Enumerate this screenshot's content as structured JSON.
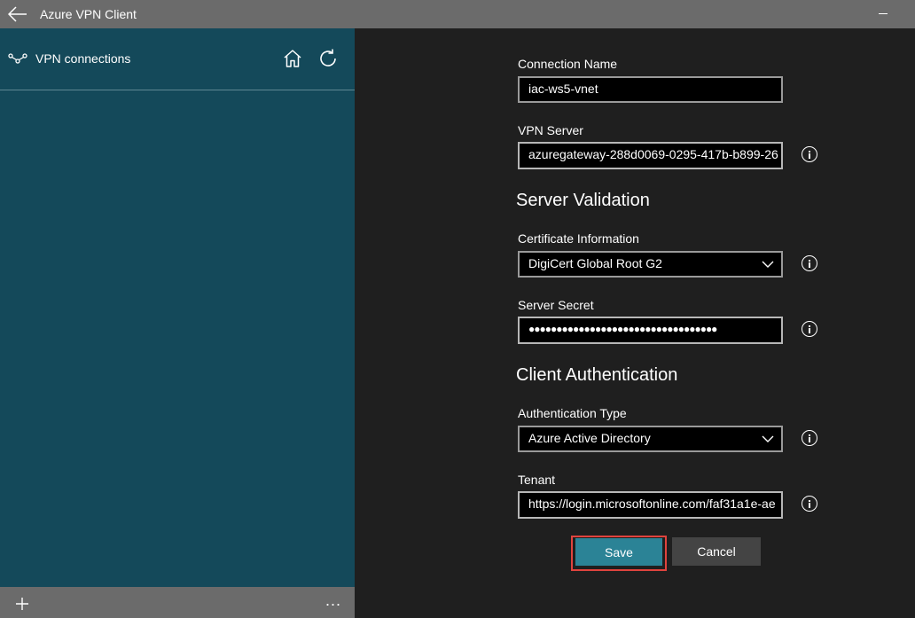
{
  "window": {
    "title": "Azure VPN Client"
  },
  "sidebar": {
    "title": "VPN connections",
    "icons": [
      "vpn-icon",
      "home-icon",
      "refresh-icon",
      "add-icon",
      "more-icon"
    ],
    "more_label": "..."
  },
  "form": {
    "connection_name": {
      "label": "Connection Name",
      "value": "iac-ws5-vnet"
    },
    "vpn_server": {
      "label": "VPN Server",
      "value": "azuregateway-288d0069-0295-417b-b899-26"
    },
    "server_validation_heading": "Server Validation",
    "certificate_information": {
      "label": "Certificate Information",
      "value": "DigiCert Global Root G2"
    },
    "server_secret": {
      "label": "Server Secret",
      "value": "●●●●●●●●●●●●●●●●●●●●●●●●●●●●●●●●●●"
    },
    "client_authentication_heading": "Client Authentication",
    "authentication_type": {
      "label": "Authentication Type",
      "value": "Azure Active Directory"
    },
    "tenant": {
      "label": "Tenant",
      "value": "https://login.microsoftonline.com/faf31a1e-ae"
    }
  },
  "actions": {
    "save_label": "Save",
    "cancel_label": "Cancel"
  },
  "colors": {
    "sidebar_bg": "#14495a",
    "titlebar_bg": "#6b6b6b",
    "content_bg": "#1f1f1f",
    "save_bg": "#2b8396",
    "highlight": "#e0443e"
  }
}
